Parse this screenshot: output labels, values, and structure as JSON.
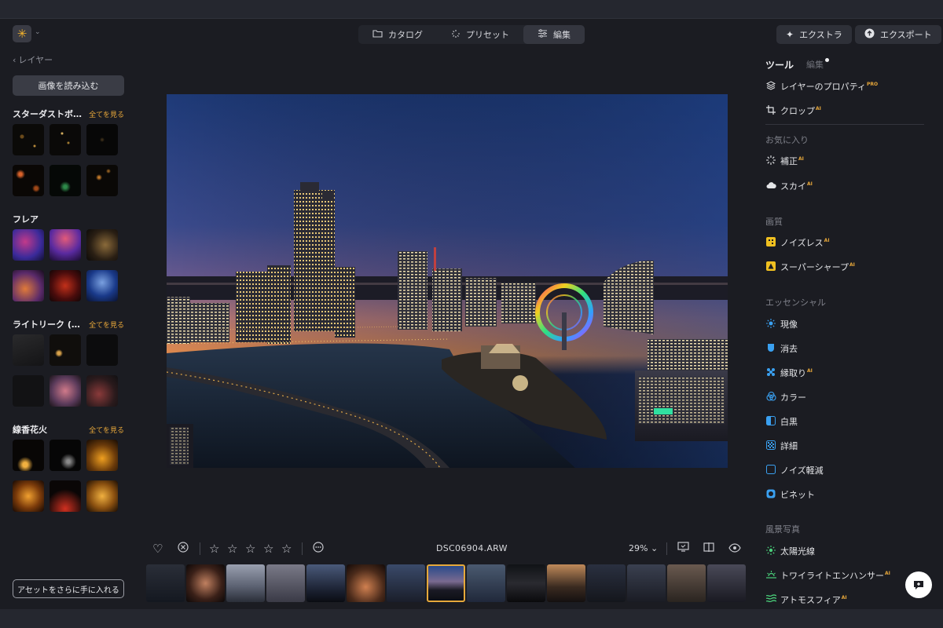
{
  "header": {
    "logo_glyph": "✳",
    "tabs": [
      {
        "label": "カタログ",
        "icon": "folder-icon"
      },
      {
        "label": "プリセット",
        "icon": "preset-icon"
      },
      {
        "label": "編集",
        "icon": "sliders-icon"
      }
    ],
    "active_tab": "編集",
    "extras_label": "エクストラ",
    "export_label": "エクスポート"
  },
  "left": {
    "back_label": "レイヤー",
    "load_button": "画像を読み込む",
    "sections": [
      {
        "title": "スターダストボ…",
        "link": "全てを見る"
      },
      {
        "title": "フレア",
        "link": ""
      },
      {
        "title": "ライトリーク (…",
        "link": "全てを見る"
      },
      {
        "title": "線香花火",
        "link": "全てを見る"
      }
    ],
    "get_assets_button": "アセットをさらに手に入れる"
  },
  "center": {
    "filename": "DSC06904.ARW",
    "zoom": "29%",
    "rating_stars": 5
  },
  "right": {
    "tab_tools": "ツール",
    "tab_edits": "編集",
    "pro_tag": "PRO",
    "ai_tag": "AI",
    "items_top": [
      {
        "label": "レイヤーのプロパティ",
        "icon": "layers-icon",
        "tag": "PRO"
      },
      {
        "label": "クロップ",
        "icon": "crop-icon",
        "tag": "AI"
      }
    ],
    "groups": [
      {
        "title": "お気に入り",
        "items": [
          {
            "label": "補正",
            "icon": "enhance-icon",
            "tag": "AI"
          },
          {
            "label": "スカイ",
            "icon": "cloud-icon",
            "tag": "AI"
          }
        ]
      },
      {
        "title": "画質",
        "items": [
          {
            "label": "ノイズレス",
            "icon": "noiseless-icon",
            "tag": "AI"
          },
          {
            "label": "スーパーシャープ",
            "icon": "supersharp-icon",
            "tag": "AI"
          }
        ]
      },
      {
        "title": "エッセンシャル",
        "items": [
          {
            "label": "現像",
            "icon": "develop-icon",
            "tag": ""
          },
          {
            "label": "消去",
            "icon": "erase-icon",
            "tag": ""
          },
          {
            "label": "縁取り",
            "icon": "structure-icon",
            "tag": "AI"
          },
          {
            "label": "カラー",
            "icon": "color-icon",
            "tag": ""
          },
          {
            "label": "白黒",
            "icon": "bw-icon",
            "tag": ""
          },
          {
            "label": "詳細",
            "icon": "details-icon",
            "tag": ""
          },
          {
            "label": "ノイズ軽減",
            "icon": "denoise-icon",
            "tag": ""
          },
          {
            "label": "ビネット",
            "icon": "vignette-icon",
            "tag": ""
          }
        ]
      },
      {
        "title": "風景写真",
        "items": [
          {
            "label": "太陽光線",
            "icon": "sunrays-icon",
            "tag": ""
          },
          {
            "label": "トワイライトエンハンサー",
            "icon": "twilight-icon",
            "tag": "AI"
          },
          {
            "label": "アトモスフィア",
            "icon": "atmosphere-icon",
            "tag": "AI"
          }
        ]
      }
    ]
  },
  "colors": {
    "accent": "#e7a73a",
    "background": "#1b1c22",
    "panel_button": "#2e3038"
  }
}
